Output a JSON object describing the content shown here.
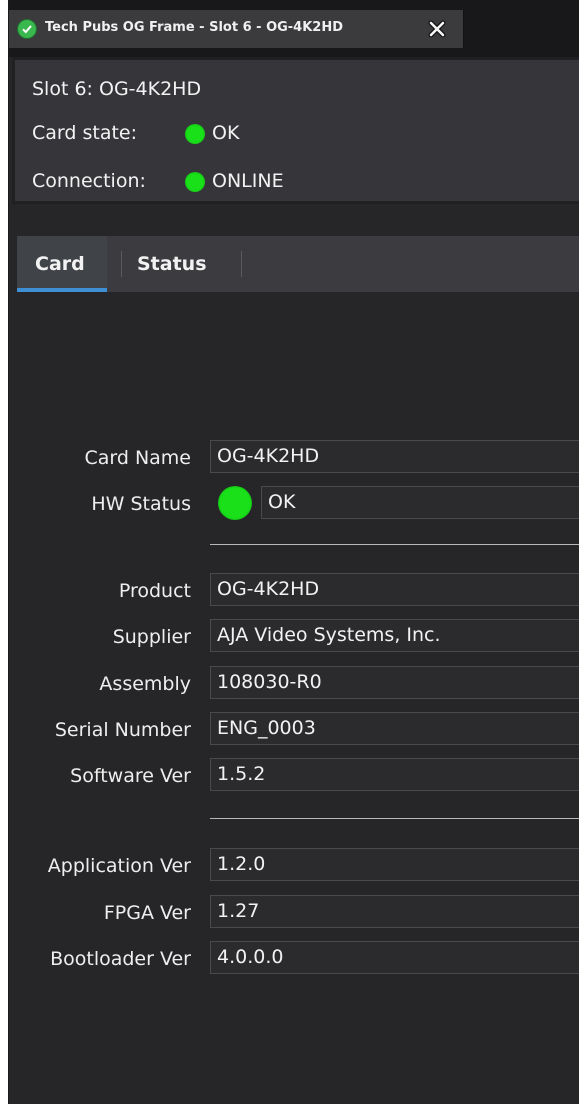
{
  "window": {
    "tab_title": "Tech Pubs OG Frame - Slot 6 - OG-4K2HD",
    "tab_status_icon": "check-circle-icon",
    "close_icon": "close-x-icon"
  },
  "header": {
    "slot_line": "Slot 6: OG-4K2HD",
    "card_state_label": "Card state:",
    "card_state_value": "OK",
    "connection_label": "Connection:",
    "connection_value": "ONLINE",
    "status_color": "#19e019"
  },
  "tabs": [
    {
      "label": "Card",
      "active": true
    },
    {
      "label": "Status",
      "active": false
    }
  ],
  "card": {
    "fields_group1": [
      {
        "label": "Card Name",
        "value": "OG-4K2HD"
      },
      {
        "label": "HW Status",
        "value": "OK"
      }
    ],
    "fields_group2": [
      {
        "label": "Product",
        "value": "OG-4K2HD"
      },
      {
        "label": "Supplier",
        "value": "AJA Video Systems, Inc."
      },
      {
        "label": "Assembly",
        "value": "108030-R0"
      },
      {
        "label": "Serial Number",
        "value": "ENG_0003"
      },
      {
        "label": "Software Ver",
        "value": "1.5.2"
      }
    ],
    "fields_group3": [
      {
        "label": "Application Ver",
        "value": "1.2.0"
      },
      {
        "label": "FPGA Ver",
        "value": "1.27"
      },
      {
        "label": "Bootloader Ver",
        "value": "4.0.0.0"
      }
    ]
  },
  "colors": {
    "accent": "#3f8fd4",
    "ok_green": "#19e019",
    "background": "#262629"
  }
}
